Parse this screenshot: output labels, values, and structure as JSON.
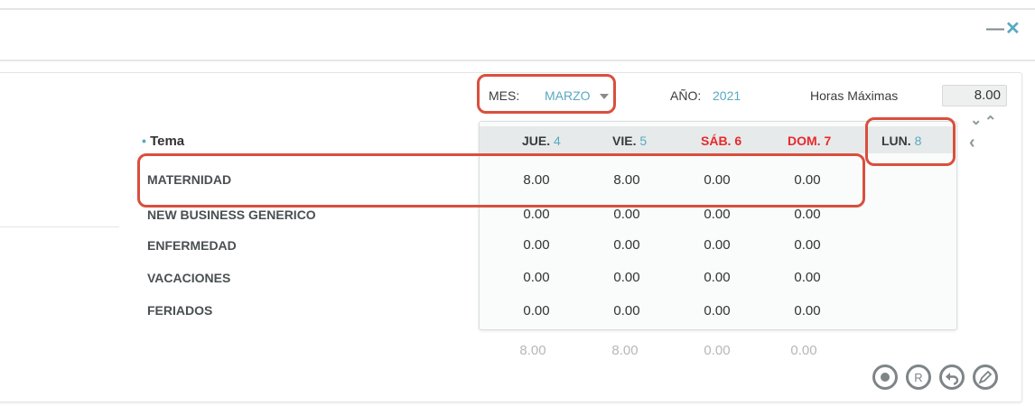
{
  "window": {
    "minimize_glyph": "—",
    "close_glyph": "✕"
  },
  "filters": {
    "month_label": "MES:",
    "month_value": "MARZO",
    "year_label": "AÑO:",
    "year_value": "2021",
    "max_hours_label": "Horas Máximas",
    "max_hours_value": "8.00"
  },
  "grid": {
    "tema_header": "Tema",
    "days": [
      {
        "name": "JUE.",
        "num": "4",
        "weekend": false
      },
      {
        "name": "VIE.",
        "num": "5",
        "weekend": false
      },
      {
        "name": "SÁB.",
        "num": "6",
        "weekend": true
      },
      {
        "name": "DOM.",
        "num": "7",
        "weekend": true
      },
      {
        "name": "LUN.",
        "num": "8",
        "weekend": false
      }
    ],
    "rows": [
      {
        "label": "MATERNIDAD",
        "values": [
          "8.00",
          "8.00",
          "0.00",
          "0.00"
        ]
      },
      {
        "label": "NEW BUSINESS GENERICO",
        "values": [
          "0.00",
          "0.00",
          "0.00",
          "0.00"
        ]
      },
      {
        "label": "ENFERMEDAD",
        "values": [
          "0.00",
          "0.00",
          "0.00",
          "0.00"
        ]
      },
      {
        "label": "VACACIONES",
        "values": [
          "0.00",
          "0.00",
          "0.00",
          "0.00"
        ]
      },
      {
        "label": "FERIADOS",
        "values": [
          "0.00",
          "0.00",
          "0.00",
          "0.00"
        ]
      }
    ],
    "totals": [
      "8.00",
      "8.00",
      "0.00",
      "0.00"
    ]
  },
  "colors": {
    "accent": "#5aa9c0",
    "weekend": "#e8292c",
    "highlight": "#d94f3d"
  },
  "icons": [
    "minimize-icon",
    "close-icon",
    "dropdown-arrow-icon",
    "chevron-down-icon",
    "chevron-up-icon",
    "chevron-left-icon",
    "record-icon",
    "registered-icon",
    "undo-icon",
    "edit-icon"
  ]
}
